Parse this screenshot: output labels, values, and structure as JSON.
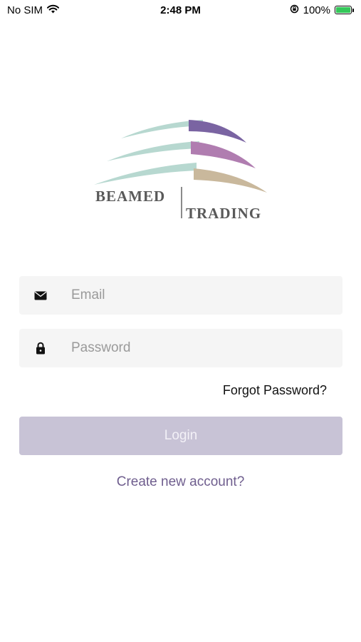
{
  "status_bar": {
    "carrier": "No SIM",
    "time": "2:48 PM",
    "battery_text": "100%"
  },
  "logo": {
    "word_top": "BEAMED",
    "word_bottom": "TRADING",
    "colors": {
      "teal": "#b7d8d0",
      "purple_dark": "#7a64a2",
      "purple_light": "#b07db0",
      "tan": "#c9b89c",
      "text": "#595959"
    }
  },
  "form": {
    "email_placeholder": "Email",
    "password_placeholder": "Password",
    "forgot_label": "Forgot Password?",
    "login_label": "Login",
    "create_account_label": "Create new account?"
  },
  "colors": {
    "field_bg": "#f5f5f5",
    "login_bg": "#c8c3d6",
    "link": "#6f5e8e"
  }
}
